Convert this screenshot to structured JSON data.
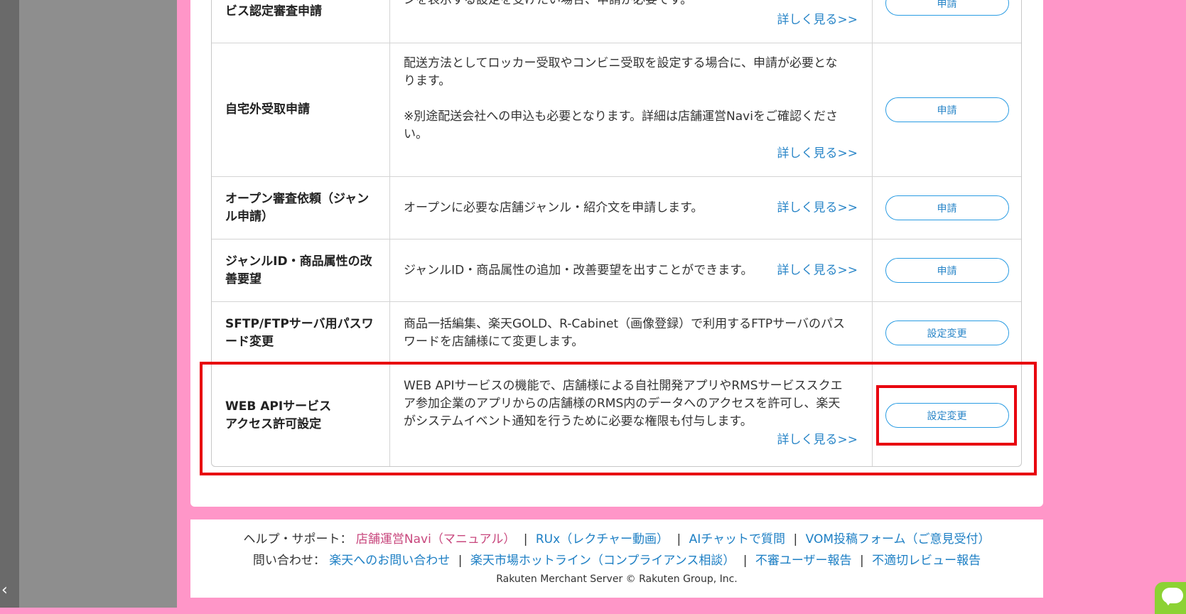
{
  "rows": [
    {
      "name": "ビス認定審査申請",
      "desc": "ンを表示する設定を受けたい場合、申請が必要です。",
      "more": "詳しく見る>>",
      "button": "申請"
    },
    {
      "name": "自宅外受取申請",
      "desc_lines": [
        "配送方法としてロッカー受取やコンビニ受取を設定する場合に、申請が必要とな",
        "ります。",
        "",
        "※別途配送会社への申込も必要となります。詳細は店舗運営Naviをご確認くださ",
        "い。"
      ],
      "more": "詳しく見る>>",
      "button": "申請"
    },
    {
      "name_lines": [
        "オープン審査依頼（ジャン",
        "ル申請）"
      ],
      "desc": "オープンに必要な店舗ジャンル・紹介文を申請します。",
      "more": "詳しく見る>>",
      "button": "申請"
    },
    {
      "name_lines": [
        "ジャンルID・商品属性の改",
        "善要望"
      ],
      "desc": "ジャンルID・商品属性の追加・改善要望を出すことができます。",
      "more": "詳しく見る>>",
      "button": "申請"
    },
    {
      "name_lines": [
        "SFTP/FTPサーバ用パスワ",
        "ード変更"
      ],
      "desc_lines": [
        "商品一括編集、楽天GOLD、R-Cabinet（画像登録）で利用するFTPサーバのパス",
        "ワードを店舗様にて変更します。"
      ],
      "button": "設定変更"
    },
    {
      "name_lines": [
        "WEB APIサービス",
        "アクセス許可設定"
      ],
      "desc_lines": [
        "WEB APIサービスの機能で、店舗様による自社開発アプリやRMSサービススクエ",
        "ア参加企業のアプリからの店舗様のRMS内のデータへのアクセスを許可し、楽天",
        "がシステムイベント通知を行うために必要な権限も付与します。"
      ],
      "more": "詳しく見る>>",
      "button": "設定変更"
    }
  ],
  "footer": {
    "help_label": "ヘルプ・サポート：",
    "help_links": [
      "店舗運営Navi（マニュアル）",
      "RUx（レクチャー動画）",
      "AIチャットで質問",
      "VOM投稿フォーム（ご意見受付）"
    ],
    "contact_label": "問い合わせ：",
    "contact_links": [
      "楽天へのお問い合わせ",
      "楽天市場ホットライン（コンプライアンス相談）",
      "不審ユーザー報告",
      "不適切レビュー報告"
    ],
    "separator": "|",
    "copyright": "Rakuten Merchant Server © Rakuten Group, Inc."
  },
  "sidebar": {
    "collapse_glyph": "‹"
  },
  "colors": {
    "background": "#ff96c8",
    "link_blue": "#2a86c8",
    "link_pink": "#c8477d",
    "highlight": "#e8000e",
    "chat": "#8cd234"
  },
  "icons": {
    "collapse": "chevron-left-icon",
    "chat": "chat-bubble-icon"
  }
}
